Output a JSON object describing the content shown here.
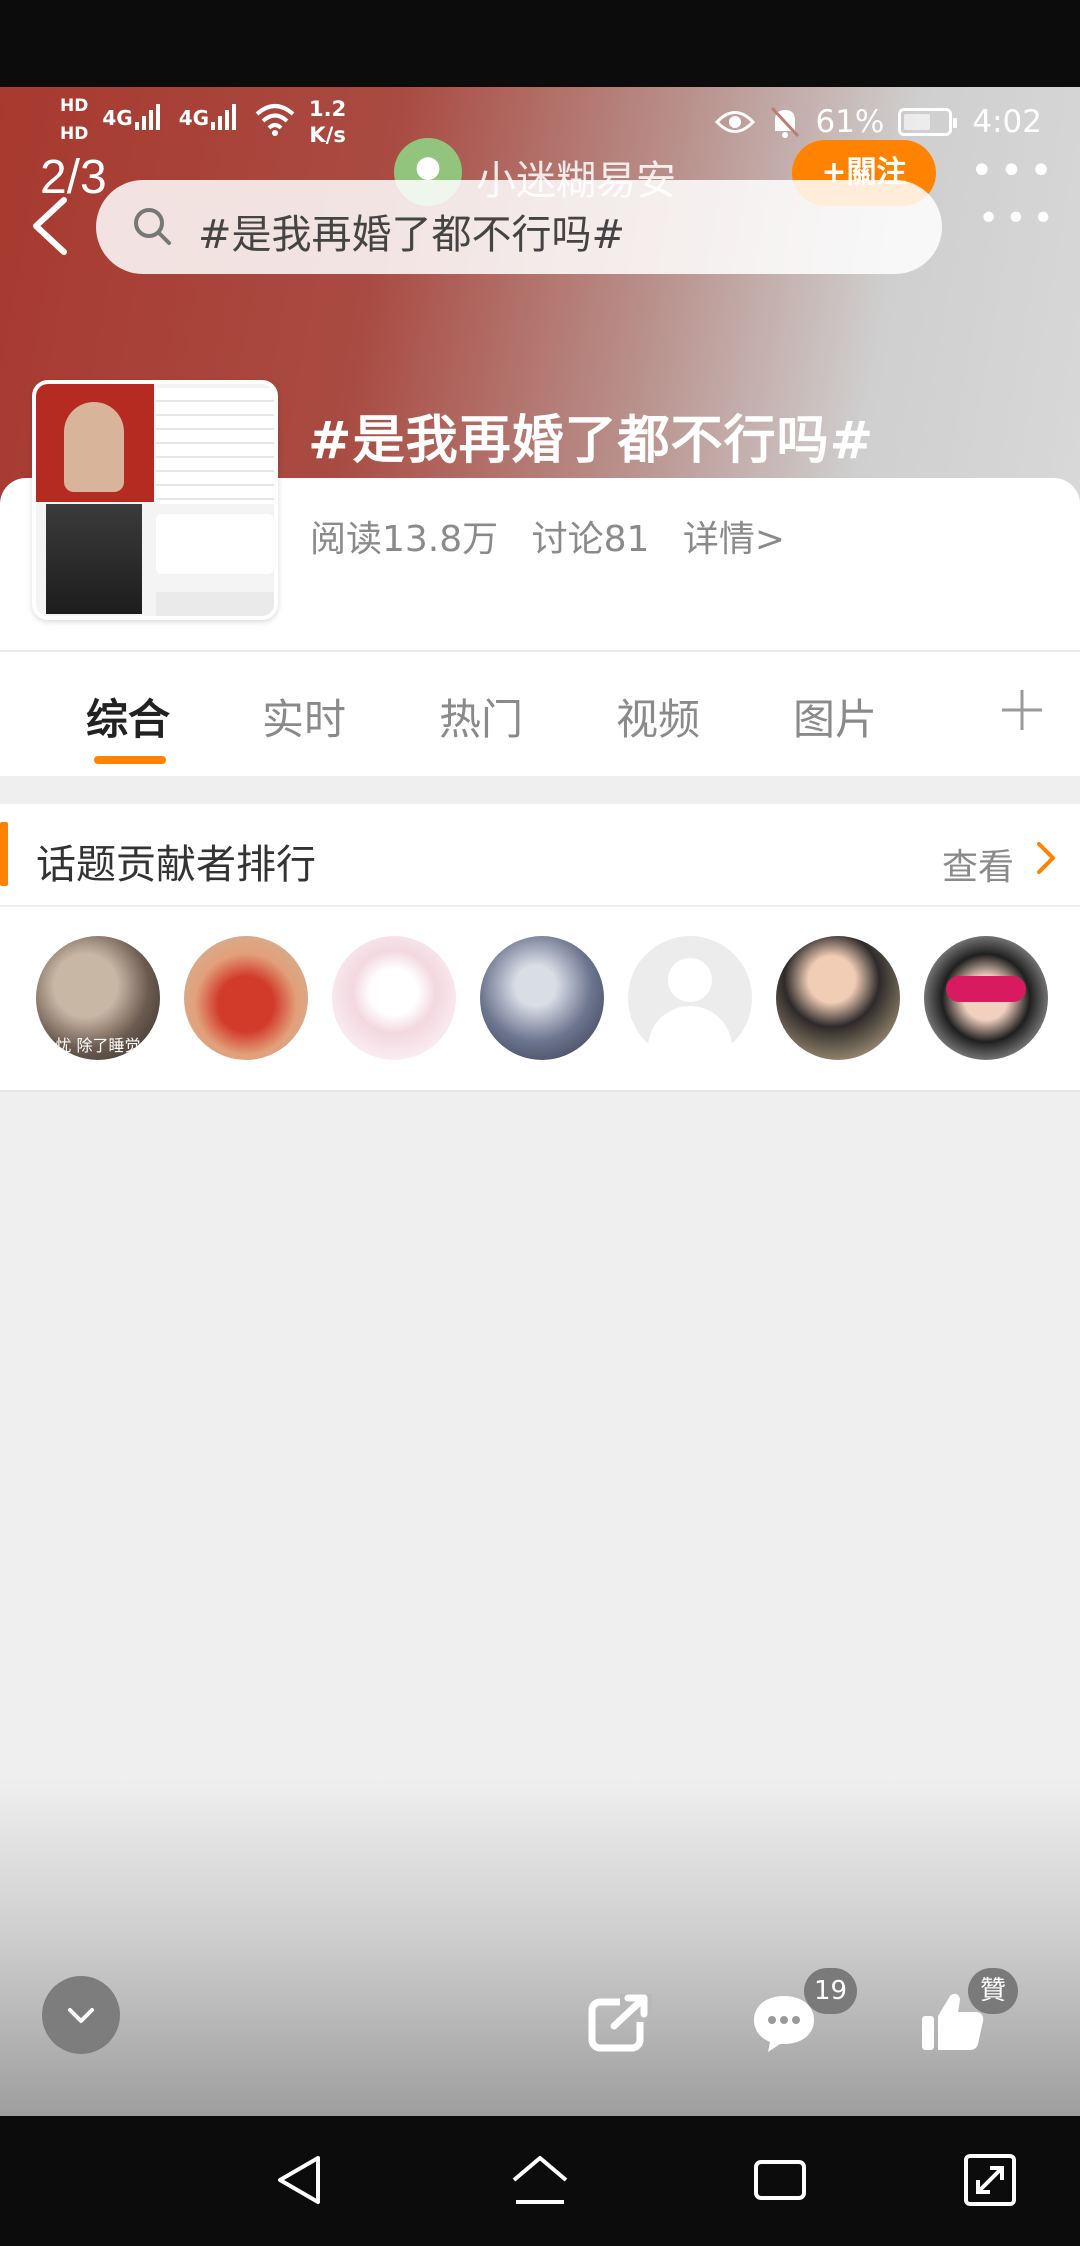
{
  "status_bar": {
    "hd1": "HD",
    "hd2": "HD",
    "sig1": "4G",
    "sig2": "4G",
    "speed_value": "1.2",
    "speed_unit": "K/s",
    "battery": "61%",
    "battery_level": 0.61,
    "time": "4:02"
  },
  "header": {
    "page_counter": "2/3",
    "user_name": "小迷糊易安",
    "follow_label": "+關注",
    "more_icon": "more-dots-icon"
  },
  "search": {
    "query": "#是我再婚了都不行吗#",
    "icon": "search-icon"
  },
  "topic": {
    "title": "#是我再婚了都不行吗#",
    "reads": "阅读13.8万",
    "discussions": "讨论81",
    "details": "详情>"
  },
  "tabs": [
    {
      "label": "综合",
      "active": true
    },
    {
      "label": "实时",
      "active": false
    },
    {
      "label": "热门",
      "active": false
    },
    {
      "label": "视频",
      "active": false
    },
    {
      "label": "图片",
      "active": false
    }
  ],
  "contributors": {
    "title": "话题贡献者排行",
    "more_label": "查看",
    "avatar_caption": "忧 除了睡觉"
  },
  "actions": {
    "comment_count": "19",
    "like_label": "贊"
  },
  "colors": {
    "accent": "#ff8200",
    "header_red": "#a8392f"
  }
}
